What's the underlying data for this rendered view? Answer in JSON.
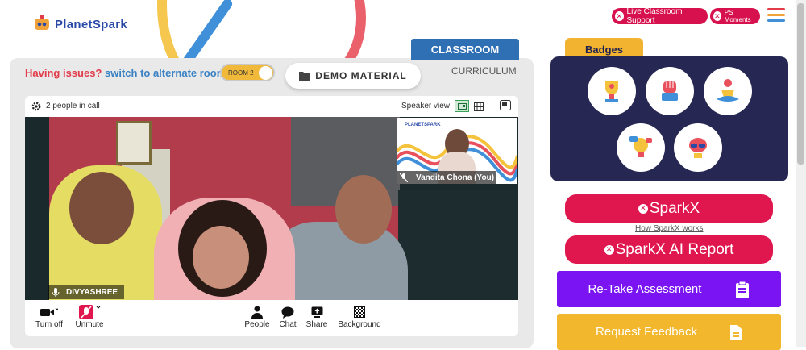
{
  "brand": {
    "logo_text": "PlanetSpark"
  },
  "header": {
    "live_support": "Live Classroom Support",
    "ps_moments": "PS Moments"
  },
  "classroom": {
    "tab_classroom": "CLASSROOM",
    "tab_curriculum": "CURRICULUM",
    "issues_text": "Having issues?",
    "alternate_link": "switch to alternate room",
    "room_label": "ROOM 2",
    "demo_material": "DEMO MATERIAL"
  },
  "call": {
    "people_count": "2 people in call",
    "view_label": "Speaker view",
    "main_participant": "DIVYASHREE",
    "self_participant": "Vandita Chona (You)",
    "pip_logo": "PLANETSPARK",
    "controls": {
      "camera": "Turn off",
      "mic": "Unmute",
      "people": "People",
      "chat": "Chat",
      "share": "Share",
      "background": "Background"
    }
  },
  "sidebar": {
    "badges_title": "Badges",
    "sparkx_label": "SparkX",
    "how_sparkx": "How SparkX works",
    "sparkx_report": "SparkX AI Report",
    "retake": "Re-Take Assessment",
    "feedback": "Request Feedback"
  },
  "colors": {
    "brand_red": "#e0164f",
    "navy": "#262752",
    "purple": "#7a14f2",
    "yellow": "#f2b72c",
    "blue_tab": "#2f6fb3"
  }
}
